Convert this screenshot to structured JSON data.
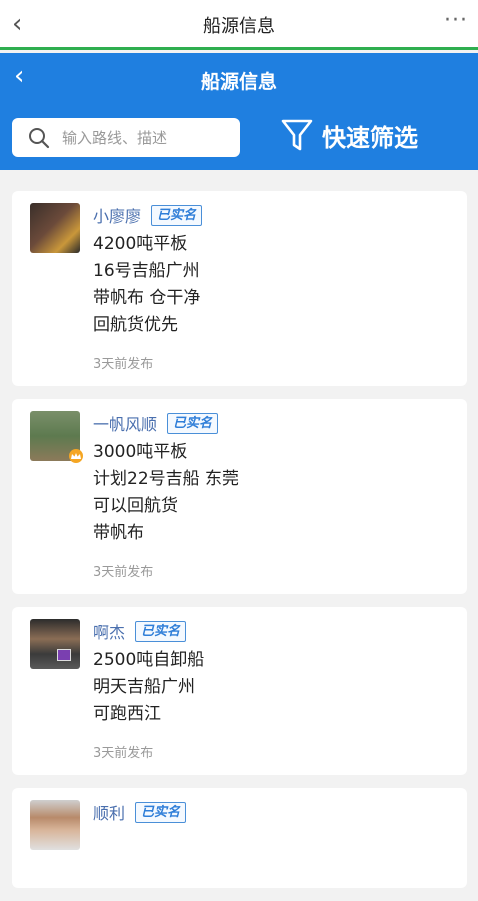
{
  "app_bar": {
    "title": "船源信息",
    "back_icon": "chevron-left-icon",
    "more_icon": "more-dots-icon"
  },
  "header": {
    "title": "船源信息",
    "search_placeholder": "输入路线、描述",
    "filter_label": "快速筛选",
    "brand_color": "#1f7fe0"
  },
  "cards": [
    {
      "name": "小廖廖",
      "badge": "已实名",
      "lines": [
        "4200吨平板",
        "16号吉船广州",
        "带帆布 仓干净",
        "回航货优先"
      ],
      "time": "3天前发布"
    },
    {
      "name": "一帆风顺",
      "badge": "已实名",
      "lines": [
        "3000吨平板",
        "计划22号吉船 东莞",
        "可以回航货",
        "带帆布"
      ],
      "time": "3天前发布"
    },
    {
      "name": "啊杰",
      "badge": "已实名",
      "lines": [
        "2500吨自卸船",
        "明天吉船广州",
        "可跑西江"
      ],
      "time": "3天前发布"
    },
    {
      "name": "顺利",
      "badge": "已实名",
      "lines": [],
      "time": ""
    }
  ]
}
